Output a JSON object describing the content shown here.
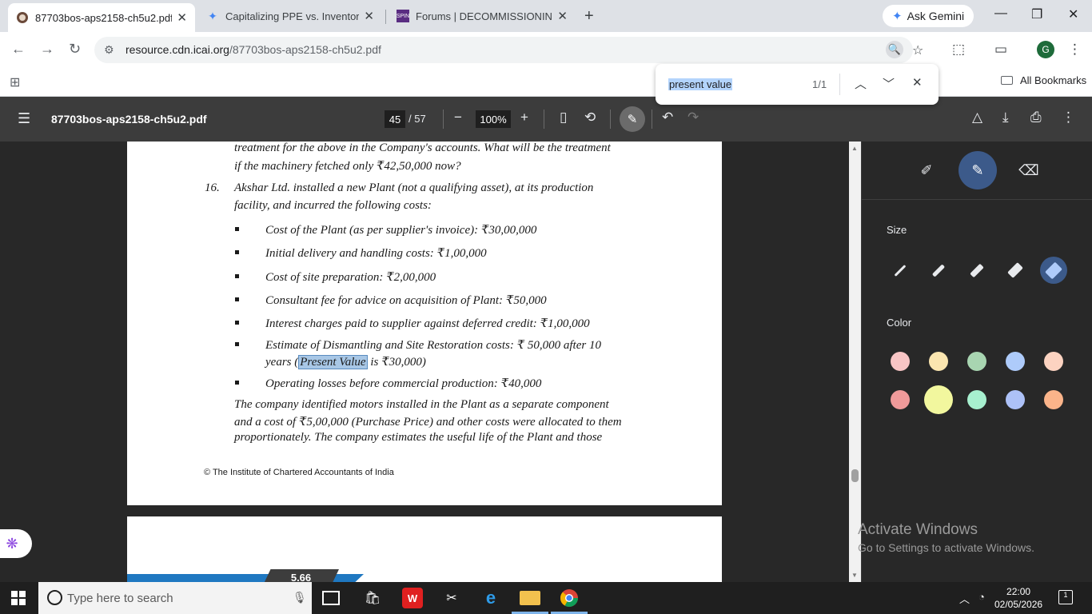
{
  "tabs": [
    {
      "title": "87703bos-aps2158-ch5u2.pdf",
      "active": true
    },
    {
      "title": "Capitalizing PPE vs. Inventory C",
      "active": false
    },
    {
      "title": "Forums | DECOMMISSIONING C",
      "active": false
    }
  ],
  "gemini_label": "Ask Gemini",
  "address": {
    "domain": "resource.cdn.icai.org",
    "path": "/87703bos-aps2158-ch5u2.pdf"
  },
  "bookmarks": {
    "all_label": "All Bookmarks"
  },
  "find": {
    "query": "present value",
    "count": "1/1"
  },
  "pdf": {
    "title": "87703bos-aps2158-ch5u2.pdf",
    "page_current": "45",
    "page_total": "/ 57",
    "zoom": "100%"
  },
  "document": {
    "line1": "treatment for the above in the Company's accounts. What will be the treatment",
    "line2": "if the machinery fetched only ₹42,50,000 now?",
    "q_number": "16.",
    "q_line1": "Akshar Ltd. installed a new Plant (not a qualifying asset), at its production",
    "q_line2": "facility, and incurred the following costs:",
    "bullets": [
      "Cost of the Plant (as per supplier's invoice):  ₹30,00,000",
      "Initial delivery and handling costs:  ₹1,00,000",
      "Cost of site preparation:  ₹2,00,000",
      "Consultant fee for advice on acquisition of Plant:  ₹50,000",
      "Interest charges paid to supplier against deferred credit:  ₹1,00,000"
    ],
    "dismantle_line1": "Estimate of Dismantling and Site Restoration costs:  ₹ 50,000 after 10",
    "dismantle_pre": "years (",
    "dismantle_hl": "Present Value",
    "dismantle_post": " is  ₹30,000)",
    "bullet_last": "Operating losses before commercial production:  ₹40,000",
    "para_line1": "The company identified motors installed in the Plant as a separate component",
    "para_line2": "and a cost of ₹5,00,000 (Purchase Price) and other costs were allocated to them",
    "para_line3": "proportionately. The company estimates the useful life of the Plant and those",
    "footer": "© The Institute of Chartered Accountants of India",
    "next_page_label": "5.66"
  },
  "panel": {
    "size_label": "Size",
    "color_label": "Color",
    "colors_row1": [
      "#f8c5c5",
      "#fbe6b0",
      "#a8d5b1",
      "#aecbfa",
      "#fcd3c1"
    ],
    "colors_row2": [
      "#f09a9a",
      "#f2f79e",
      "#a7f0cf",
      "#adc1f7",
      "#fbb48a"
    ],
    "active_color": "#f2f79e"
  },
  "watermark": {
    "line1": "Activate Windows",
    "line2": "Go to Settings to activate Windows."
  },
  "taskbar": {
    "search_placeholder": "Type here to search",
    "time": "22:00",
    "date": "02/05/2026",
    "notifications": "1"
  }
}
